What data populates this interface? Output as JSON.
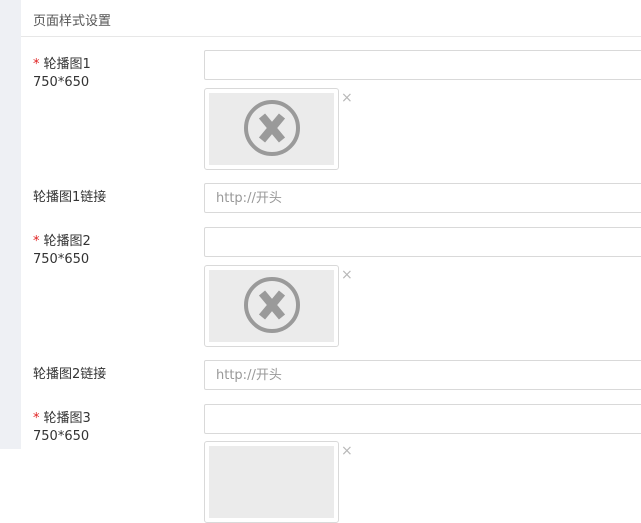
{
  "panel": {
    "title": "页面样式设置"
  },
  "fields": {
    "banner1": {
      "label": "轮播图1",
      "size": "750*650",
      "required_mark": "*"
    },
    "banner1_link": {
      "label": "轮播图1链接",
      "placeholder": "http://开头"
    },
    "banner2": {
      "label": "轮播图2",
      "size": "750*650",
      "required_mark": "*"
    },
    "banner2_link": {
      "label": "轮播图2链接",
      "placeholder": "http://开头"
    },
    "banner3": {
      "label": "轮播图3",
      "size": "750*650",
      "required_mark": "*"
    }
  },
  "icons": {
    "remove": "×",
    "broken_image": "broken-image-icon"
  }
}
